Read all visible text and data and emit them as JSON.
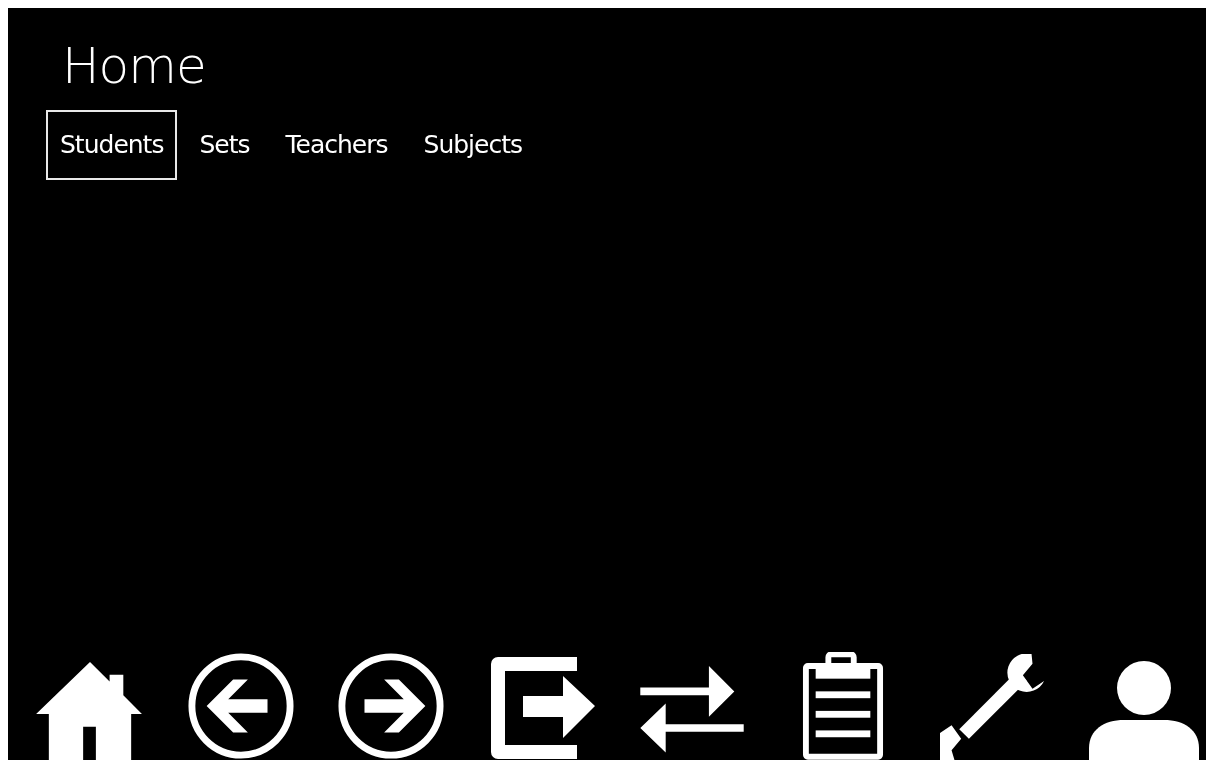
{
  "page": {
    "title": "Home"
  },
  "tabs": [
    {
      "label": "Students",
      "selected": true
    },
    {
      "label": "Sets",
      "selected": false
    },
    {
      "label": "Teachers",
      "selected": false
    },
    {
      "label": "Subjects",
      "selected": false
    }
  ],
  "toolbar": [
    {
      "kind": "home"
    },
    {
      "kind": "back"
    },
    {
      "kind": "forward"
    },
    {
      "kind": "exit"
    },
    {
      "kind": "swap"
    },
    {
      "kind": "clipboard"
    },
    {
      "kind": "wrench"
    },
    {
      "kind": "user"
    }
  ]
}
